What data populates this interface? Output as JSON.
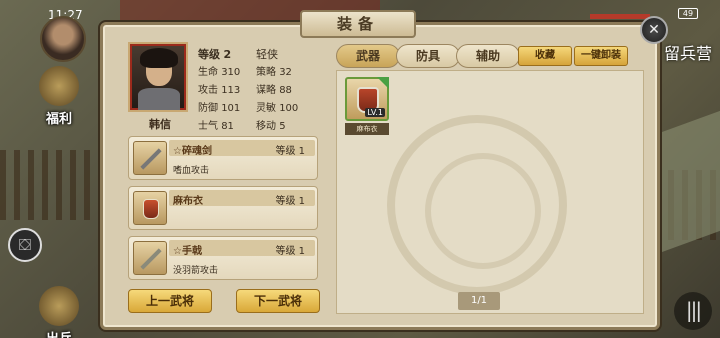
{
  "status": {
    "time": "11:27",
    "battery": "49"
  },
  "hud": {
    "fuli_label": "福利",
    "chubing_label": "出兵",
    "liuying_label": "留兵营"
  },
  "panel": {
    "title": "装备"
  },
  "hero": {
    "name": "韩信",
    "level_label": "等级",
    "level_value": "2",
    "class": "轻侠",
    "stats": [
      {
        "label": "生命",
        "value": "310"
      },
      {
        "label": "策略",
        "value": "32"
      },
      {
        "label": "攻击",
        "value": "113"
      },
      {
        "label": "谋略",
        "value": "88"
      },
      {
        "label": "防御",
        "value": "101"
      },
      {
        "label": "灵敏",
        "value": "100"
      },
      {
        "label": "士气",
        "value": "81"
      },
      {
        "label": "移动",
        "value": "5"
      }
    ]
  },
  "equipped": [
    {
      "name": "☆碎魂剑",
      "level": "等级 1",
      "desc": "嗜血攻击",
      "icon": "sword-icon"
    },
    {
      "name": "麻布衣",
      "level": "等级 1",
      "desc": "",
      "icon": "armor-icon"
    },
    {
      "name": "☆手戟",
      "level": "等级 1",
      "desc": "没羽箭攻击",
      "icon": "halberd-icon"
    }
  ],
  "nav": {
    "prev": "上一武将",
    "next": "下一武将"
  },
  "tabs": {
    "weapon": "武器",
    "armor": "防具",
    "assist": "辅助",
    "collect": "收藏",
    "unequip": "一键卸装"
  },
  "inventory": [
    {
      "name": "麻布衣",
      "level_badge": "LV.1"
    }
  ],
  "pagination": "1/1"
}
